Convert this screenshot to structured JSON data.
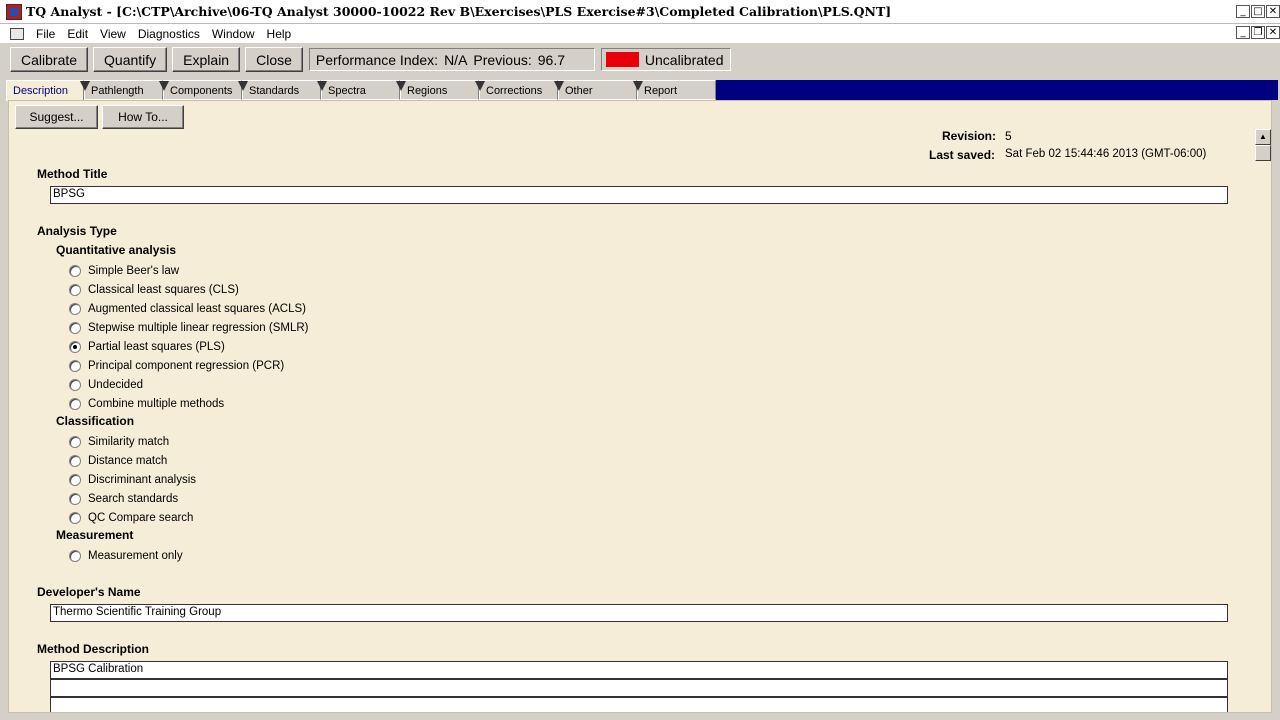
{
  "window": {
    "title": "TQ Analyst  - [C:\\CTP\\Archive\\06-TQ Analyst 30000-10022 Rev B\\Exercises\\PLS Exercise#3\\Completed Calibration\\PLS.QNT]",
    "minimize": "_",
    "maximize": "□",
    "close": "✕",
    "restore": "❐"
  },
  "menu": [
    "File",
    "Edit",
    "View",
    "Diagnostics",
    "Window",
    "Help"
  ],
  "toolbar": {
    "calibrate": "Calibrate",
    "quantify": "Quantify",
    "explain": "Explain",
    "close": "Close",
    "performance_label": "Performance Index:",
    "performance_value": "N/A",
    "previous_label": "Previous:",
    "previous_value": "96.7",
    "status_text": "Uncalibrated",
    "status_color": "#e8000b"
  },
  "tabs": [
    "Description",
    "Pathlength",
    "Components",
    "Standards",
    "Spectra",
    "Regions",
    "Corrections",
    "Other",
    "Report"
  ],
  "panel": {
    "suggest": "Suggest...",
    "howto": "How To...",
    "revision_label": "Revision:",
    "revision_value": "5",
    "last_saved_label": "Last saved:",
    "last_saved_value": "Sat Feb 02 15:44:46 2013 (GMT-06:00)",
    "method_title_label": "Method Title",
    "method_title_value": "BPSG",
    "analysis_type_label": "Analysis Type",
    "quantitative_label": "Quantitative analysis",
    "quantitative_options": [
      {
        "label": "Simple Beer's law",
        "checked": false
      },
      {
        "label": "Classical least squares (CLS)",
        "checked": false
      },
      {
        "label": "Augmented classical least squares (ACLS)",
        "checked": false
      },
      {
        "label": "Stepwise multiple linear regression (SMLR)",
        "checked": false
      },
      {
        "label": "Partial least squares (PLS)",
        "checked": true
      },
      {
        "label": "Principal component regression (PCR)",
        "checked": false
      },
      {
        "label": "Undecided",
        "checked": false
      },
      {
        "label": "Combine multiple methods",
        "checked": false
      }
    ],
    "classification_label": "Classification",
    "classification_options": [
      {
        "label": "Similarity match",
        "checked": false
      },
      {
        "label": "Distance match",
        "checked": false
      },
      {
        "label": "Discriminant analysis",
        "checked": false
      },
      {
        "label": "Search standards",
        "checked": false
      },
      {
        "label": "QC Compare search",
        "checked": false
      }
    ],
    "measurement_label": "Measurement",
    "measurement_options": [
      {
        "label": "Measurement only",
        "checked": false
      }
    ],
    "developer_label": "Developer's Name",
    "developer_value": "Thermo Scientific Training Group",
    "description_label": "Method Description",
    "description_lines": [
      "BPSG Calibration",
      "",
      ""
    ]
  }
}
